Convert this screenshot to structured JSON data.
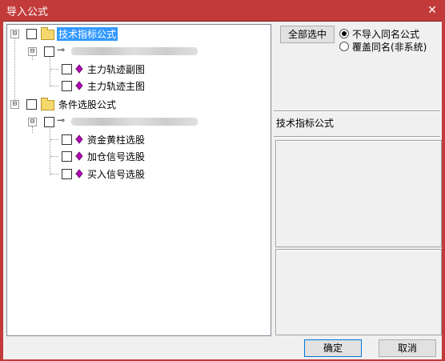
{
  "window": {
    "title": "导入公式",
    "close_glyph": "✕"
  },
  "tree": {
    "groups": [
      {
        "label": "技术指标公式",
        "selected": true,
        "formulas": [
          "主力轨迹副图",
          "主力轨迹主图"
        ]
      },
      {
        "label": "条件选股公式",
        "selected": false,
        "formulas": [
          "资金黄柱选股",
          "加仓信号选股",
          "买入信号选股"
        ]
      }
    ],
    "icons": {
      "folder": "folder-icon",
      "key": "key-icon",
      "formula": "diamond-formula-icon",
      "expand": "⊟"
    }
  },
  "toolbar": {
    "select_all_label": "全部选中",
    "options": [
      {
        "label": "不导入同名公式",
        "checked": true
      },
      {
        "label": "覆盖同名(非系统)",
        "checked": false
      }
    ]
  },
  "details": {
    "category_label": "技术指标公式"
  },
  "footer": {
    "ok_label": "确定",
    "cancel_label": "取消"
  },
  "colors": {
    "titlebar": "#c23a3a",
    "selection": "#3399ff",
    "formula_icon": "#b800b8"
  }
}
